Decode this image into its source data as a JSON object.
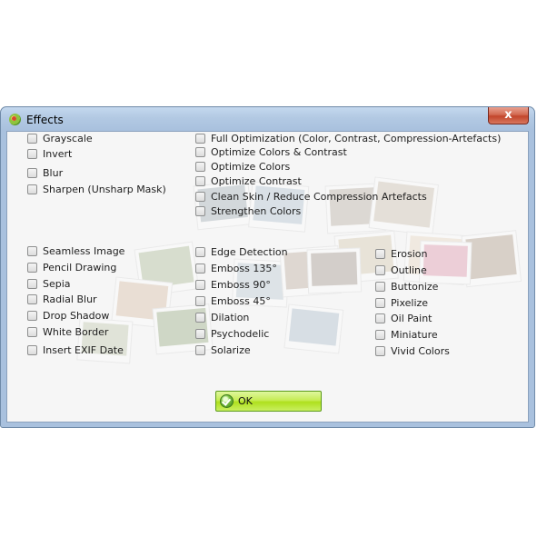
{
  "window": {
    "title": "Effects",
    "close_glyph": "x",
    "app_icon": "photo-app-icon"
  },
  "options": {
    "group1_col1": [
      "Grayscale",
      "Invert",
      "Blur",
      "Sharpen (Unsharp Mask)"
    ],
    "group1_col2": [
      "Full Optimization (Color, Contrast, Compression-Artefacts)",
      "Optimize Colors & Contrast",
      "Optimize Colors",
      "Optimize Contrast",
      "Clean Skin / Reduce Compression Artefacts",
      "Strengthen Colors"
    ],
    "group2_col1": [
      "Seamless Image",
      "Pencil Drawing",
      "Sepia",
      "Radial Blur",
      "Drop Shadow",
      "White Border",
      "Insert EXIF Date"
    ],
    "group2_col2": [
      "Edge Detection",
      "Emboss 135°",
      "Emboss 90°",
      "Emboss 45°",
      "Dilation",
      "Psychodelic",
      "Solarize"
    ],
    "group2_col3": [
      "Erosion",
      "Outline",
      "Buttonize",
      "Pixelize",
      "Oil Paint",
      "Miniature",
      "Vivid Colors"
    ]
  },
  "ok_button": {
    "label": "OK",
    "icon": "check-circle-icon"
  },
  "colors": {
    "title_bar": "#b2c9e3",
    "close_button": "#c2452b",
    "ok_button": "#afe01d",
    "client_bg": "#f6f6f6"
  }
}
